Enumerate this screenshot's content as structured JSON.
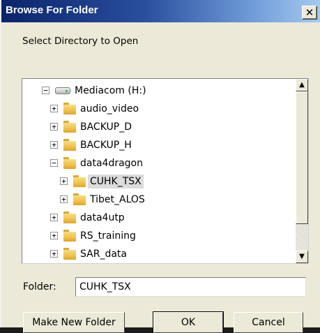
{
  "window": {
    "title": "Browse For Folder",
    "close_glyph": "✕"
  },
  "dialog": {
    "instruction": "Select Directory to Open"
  },
  "tree": {
    "items": [
      {
        "label": "Mediacom (H:)",
        "expander": "−",
        "icon": "drive-icon",
        "level": 0
      },
      {
        "label": "audio_video",
        "expander": "+",
        "icon": "folder-icon",
        "level": 1
      },
      {
        "label": "BACKUP_D",
        "expander": "+",
        "icon": "folder-icon",
        "level": 1
      },
      {
        "label": "BACKUP_H",
        "expander": "+",
        "icon": "folder-icon",
        "level": 1
      },
      {
        "label": "data4dragon",
        "expander": "−",
        "icon": "folder-icon",
        "level": 1
      },
      {
        "label": "CUHK_TSX",
        "expander": "+",
        "icon": "folder-icon",
        "level": 2,
        "selected": true
      },
      {
        "label": "Tibet_ALOS",
        "expander": "+",
        "icon": "folder-icon",
        "level": 2
      },
      {
        "label": "data4utp",
        "expander": "+",
        "icon": "folder-icon",
        "level": 1
      },
      {
        "label": "RS_training",
        "expander": "+",
        "icon": "folder-icon",
        "level": 1
      },
      {
        "label": "SAR_data",
        "expander": "+",
        "icon": "folder-icon",
        "level": 1
      }
    ],
    "scroll_up_glyph": "▲",
    "scroll_down_glyph": "▼"
  },
  "folder_field": {
    "label": "Folder:",
    "value": "CUHK_TSX"
  },
  "buttons": {
    "make_new_folder": "Make New Folder",
    "ok": "OK",
    "cancel": "Cancel"
  }
}
